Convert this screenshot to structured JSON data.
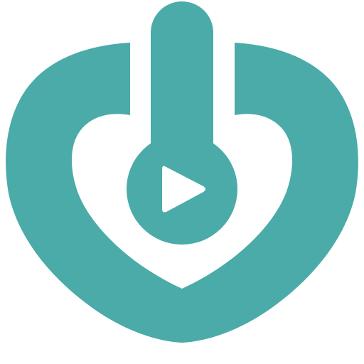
{
  "app_icon": {
    "icon_name": "heart-power-play-icon",
    "colors": {
      "primary": "#4aaba8",
      "background": "#ffffff"
    }
  }
}
